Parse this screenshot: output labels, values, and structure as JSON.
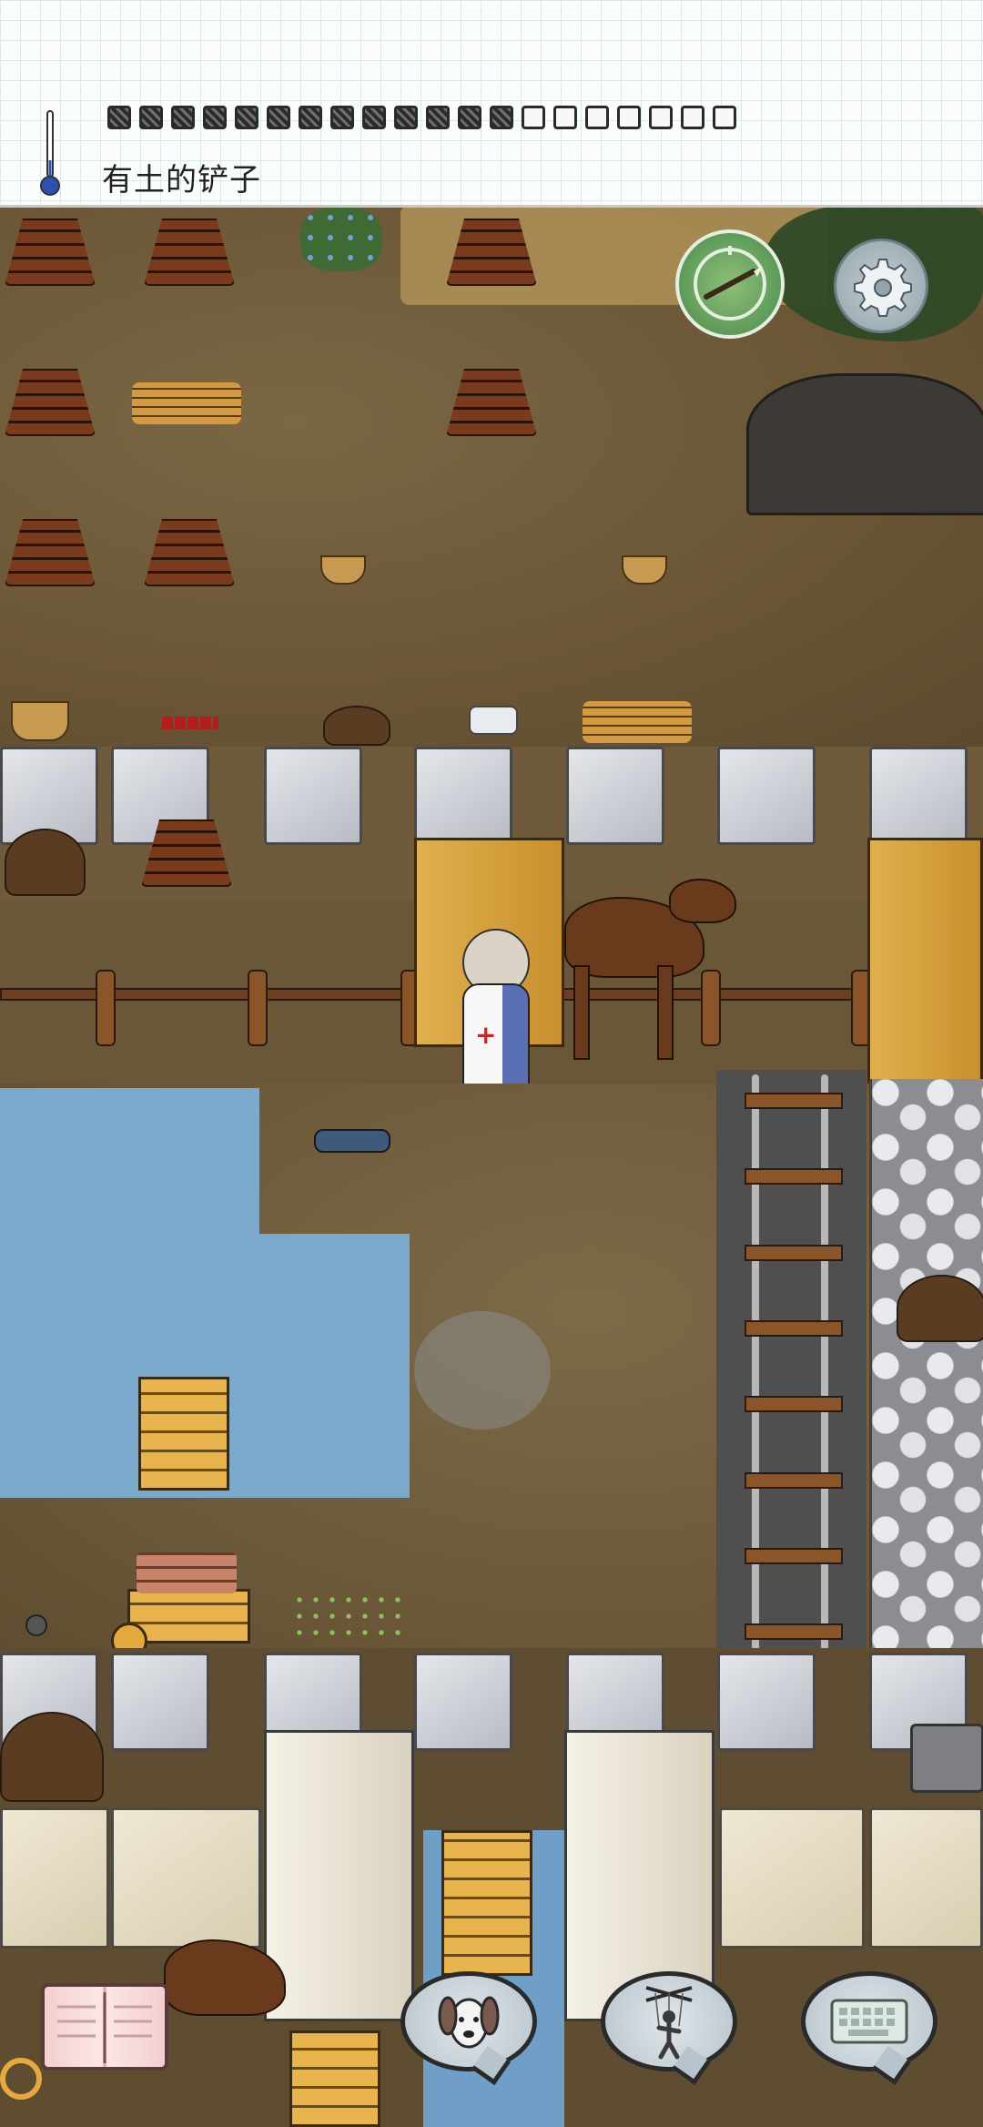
{
  "hud": {
    "held_item_label": "有土的铲子",
    "food_pips_total": 20,
    "food_pips_full": 13,
    "temperature_icon": "thermometer-icon"
  },
  "buttons": {
    "compass": "compass-icon",
    "settings": "gear-icon",
    "tech_book": "book-icon",
    "emote": "dog-icon",
    "puppet": "puppet-icon",
    "keyboard": "keyboard-icon"
  },
  "colors": {
    "ground": "#6a5535",
    "water": "#7aa9cc",
    "stone_floor": "#c9ccd3",
    "hay": "#e0b04c",
    "compass_green": "#5d9a58"
  }
}
